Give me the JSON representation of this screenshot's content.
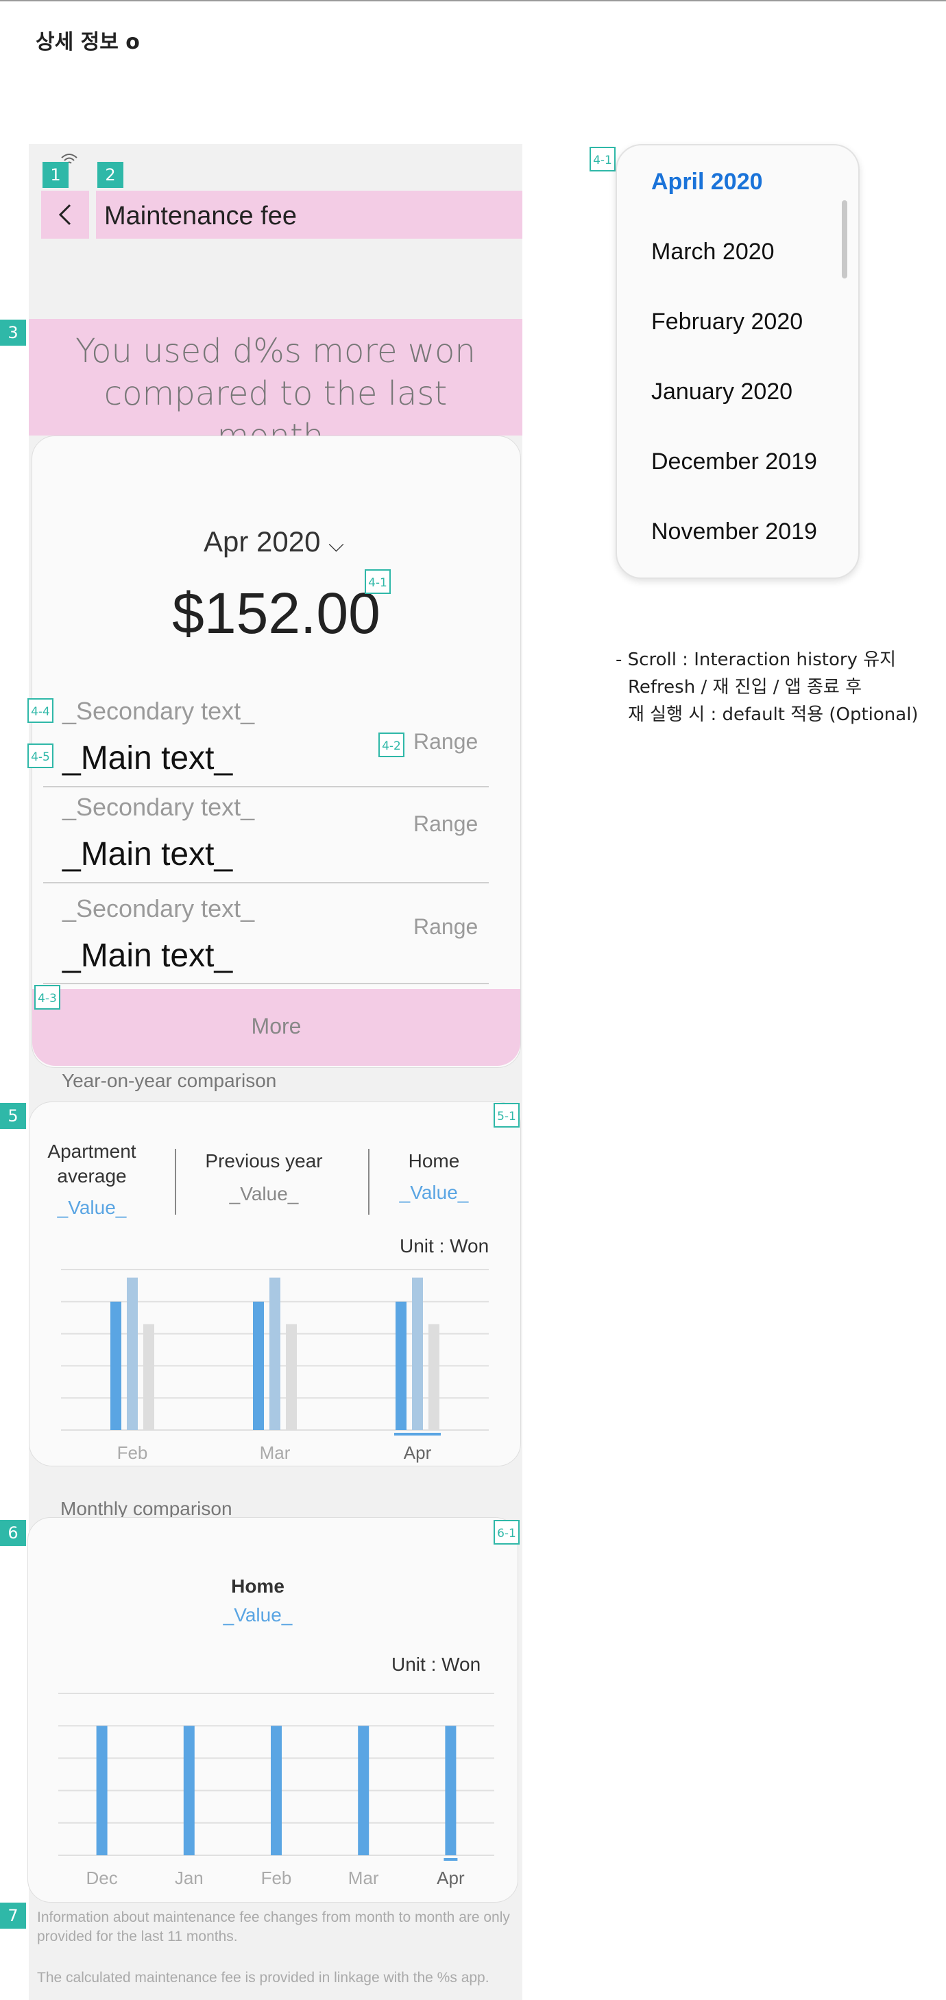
{
  "page_title": "상세 정보 o",
  "header": {
    "back_label": "<",
    "title": "Maintenance fee"
  },
  "banner": {
    "text": "You used d%s more won compared to the last month."
  },
  "summary": {
    "month_selector": "Apr 2020",
    "chevron": "⌵",
    "amount": "$152.00",
    "rows": [
      {
        "secondary": "_Secondary text_",
        "main": "_Main text_",
        "range": "Range"
      },
      {
        "secondary": "_Secondary text_",
        "main": "_Main text_",
        "range": "Range"
      },
      {
        "secondary": "_Secondary text_",
        "main": "_Main text_",
        "range": "Range"
      }
    ],
    "more_button": "More"
  },
  "yoy": {
    "section_title": "Year-on-year comparison",
    "columns": [
      {
        "label": "Apartment\naverage",
        "value": "_Value_"
      },
      {
        "label": "Previous year",
        "value": "_Value_"
      },
      {
        "label": "Home",
        "value": "_Value_"
      }
    ],
    "unit": "Unit : Won"
  },
  "monthly": {
    "section_title": "Monthly comparison",
    "label": "Home",
    "value": "_Value_",
    "unit": "Unit : Won"
  },
  "footer": {
    "note1": "Information about maintenance fee changes from month to month are only provided for the last 11 months.",
    "note2": "The calculated maintenance fee is provided in linkage with the %s app."
  },
  "dropdown": {
    "items": [
      "April 2020",
      "March 2020",
      "February 2020",
      "January 2020",
      "December 2019",
      "November 2019"
    ],
    "selected_color": "#1a73d9"
  },
  "annotation_note": {
    "line1": "- Scroll :  Interaction history 유지",
    "line2": "Refresh / 재 진입 / 앱 종료 후",
    "line3": "재 실행 시 : default 적용 (Optional)"
  },
  "tags": {
    "t1": "1",
    "t2": "2",
    "t3": "3",
    "t5": "5",
    "t6": "6",
    "t7": "7",
    "t41": "4-1",
    "t42": "4-2",
    "t43": "4-3",
    "t44": "4-4",
    "t45": "4-5",
    "t51": "5-1",
    "t61": "6-1"
  },
  "colors": {
    "home": "#5aa5e3",
    "previous_year": "#a9c8e3",
    "apartment_average": "#dddddd",
    "accent": "#5aa5e3",
    "annotation": "#2fb8a8",
    "highlight": "#f3cce5"
  },
  "chart_data": [
    {
      "type": "bar",
      "categories": [
        "Feb",
        "Mar",
        "Apr"
      ],
      "series": [
        {
          "values": [
            80,
            80,
            80
          ]
        },
        {
          "values": [
            95,
            95,
            95
          ]
        },
        {
          "values": [
            66,
            66,
            66
          ]
        }
      ],
      "grid": true,
      "selected_category": "Apr"
    },
    {
      "type": "bar",
      "categories": [
        "Dec",
        "Jan",
        "Feb",
        "Mar",
        "Apr"
      ],
      "series": [
        {
          "values": [
            80,
            80,
            80,
            80,
            80
          ]
        }
      ],
      "grid": true,
      "selected_category": "Apr"
    }
  ]
}
